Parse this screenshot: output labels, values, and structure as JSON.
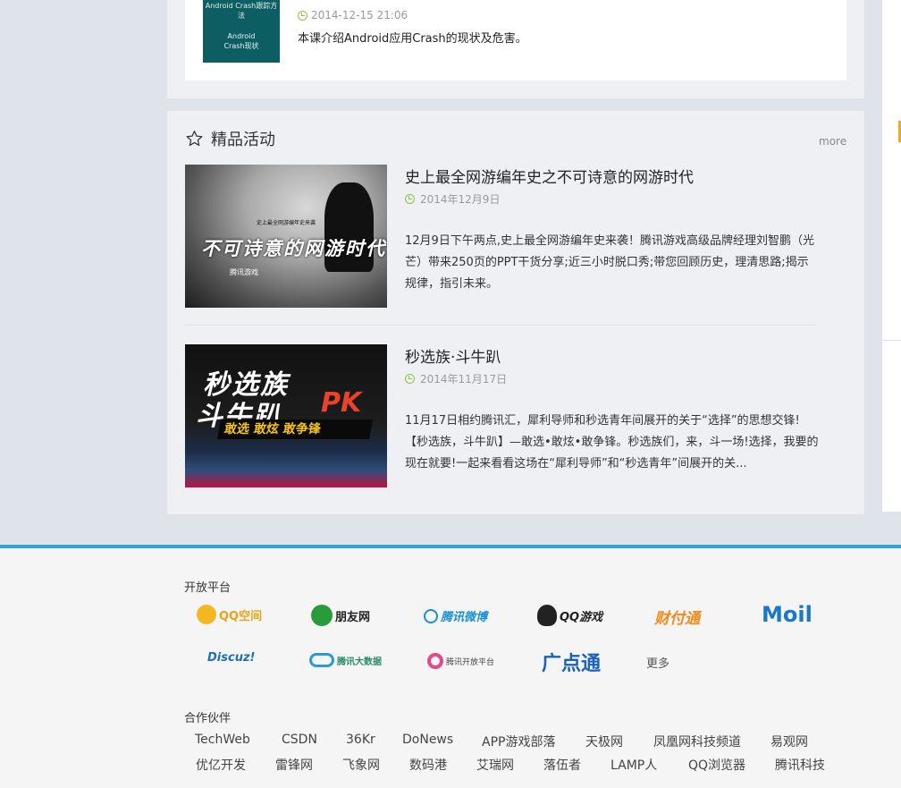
{
  "top_item": {
    "thumb_title": "Android Crash跟踪方法",
    "thumb_subtitle_1": "Android",
    "thumb_subtitle_2": "Crash现状",
    "date": "2014-12-15 21:06",
    "desc": "本课介绍Android应用Crash的现状及危害。"
  },
  "activities": {
    "title": "精品活动",
    "more_label": "more",
    "items": [
      {
        "title": "史上最全网游编年史之不可诗意的网游时代",
        "date": "2014年12月9日",
        "desc": "12月9日下午两点,史上最全网游编年史来袭！腾讯游戏高级品牌经理刘智鹏（光芒）带来250页的PPT干货分享;近三小时脱口秀;带您回顾历史，理清思路;揭示规律，指引未来。",
        "thumb_big": "不可诗意的网游时代",
        "thumb_small": "史上最全网游编年史来袭",
        "thumb_foot": "腾讯游戏"
      },
      {
        "title": "秒选族·斗牛趴",
        "date": "2014年11月17日",
        "desc": "11月17日相约腾讯汇，犀利导师和秒选青年间展开的关于“选择”的思想交锋!【秒选族，斗牛趴】—敢选•敢炫•敢争锋。秒选族们，来，斗一场!选择，我要的现在就要!一起来看看这场在“犀利导师”和“秒选青年”间展开的关...",
        "thumb_line1": "秒选族",
        "thumb_line2": "斗牛趴",
        "thumb_pk": "PK",
        "thumb_band": "敢选 敢炫 敢争锋"
      }
    ]
  },
  "footer": {
    "open_platform_title": "开放平台",
    "platforms_row1": [
      "QQ空间",
      "朋友网",
      "腾讯微博",
      "QQ游戏",
      "财付通",
      "Moil"
    ],
    "platforms_row2": [
      "Discuz!",
      "腾讯大数据",
      "腾讯开放平台",
      "广点通",
      "更多"
    ],
    "partners_title": "合作伙伴",
    "partners_row1": [
      "TechWeb",
      "CSDN",
      "36Kr",
      "DoNews",
      "APP游戏部落",
      "天极网",
      "凤凰网科技频道",
      "易观网"
    ],
    "partners_row2": [
      "优亿开发",
      "雷锋网",
      "飞象网",
      "数码港",
      "艾瑞网",
      "落伍者",
      "LAMP人",
      "QQ浏览器",
      "腾讯科技"
    ]
  },
  "colors": {
    "accent_blue": "#2ea4d8",
    "clock_green": "#8cc63e",
    "pk_red": "#e8432a",
    "band_yellow": "#f4c21b"
  }
}
